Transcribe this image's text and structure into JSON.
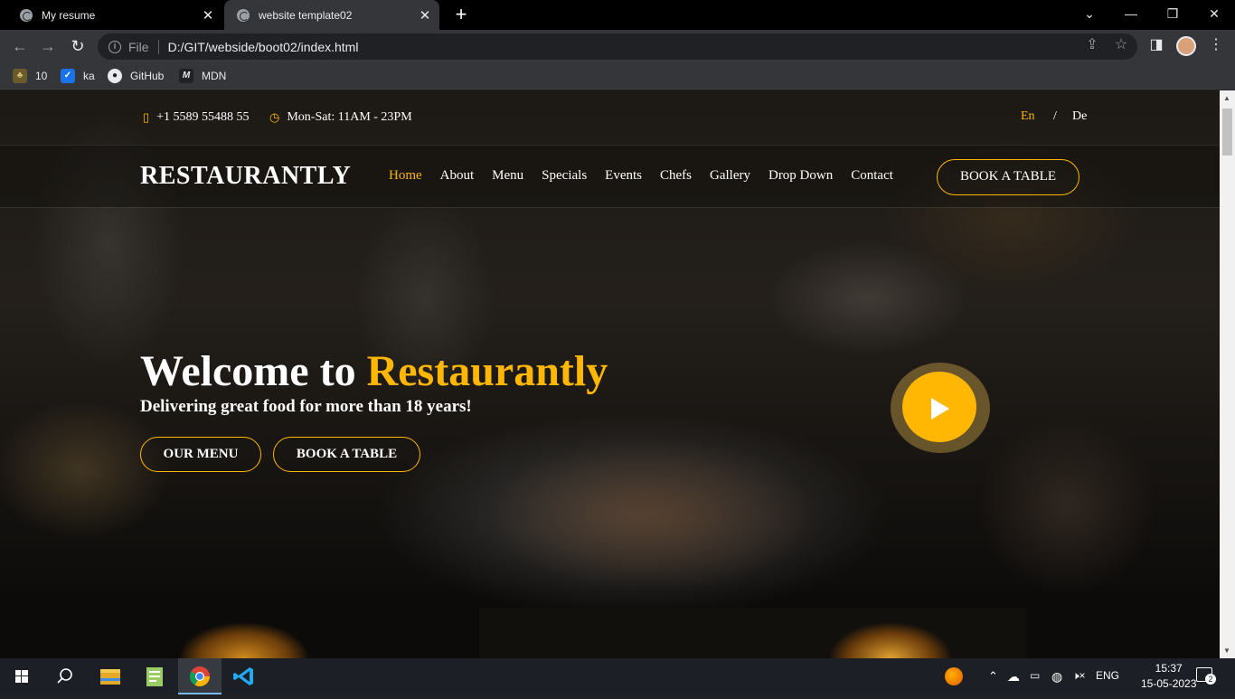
{
  "browser": {
    "tabs": [
      {
        "title": "My resume",
        "active": false
      },
      {
        "title": "website template02",
        "active": true
      }
    ],
    "url_scheme": "File",
    "url": "D:/GIT/webside/boot02/index.html",
    "bookmarks": [
      {
        "label": "10",
        "icon": "tree-icon"
      },
      {
        "label": "ka",
        "icon": "checkbox-icon"
      },
      {
        "label": "GitHub",
        "icon": "github-icon"
      },
      {
        "label": "MDN",
        "icon": "mdn-icon"
      }
    ]
  },
  "site": {
    "topbar": {
      "phone": "+1 5589 55488 55",
      "hours": "Mon-Sat: 11AM - 23PM",
      "lang_en": "En",
      "lang_sep": "/",
      "lang_de": "De"
    },
    "header": {
      "logo": "RESTAURANTLY",
      "nav": [
        "Home",
        "About",
        "Menu",
        "Specials",
        "Events",
        "Chefs",
        "Gallery",
        "Drop Down",
        "Contact"
      ],
      "active_nav": "Home",
      "book_button": "BOOK A TABLE"
    },
    "hero": {
      "title_prefix": "Welcome to ",
      "title_brand": "Restaurantly",
      "subtitle": "Delivering great food for more than 18 years!",
      "btn_menu": "OUR MENU",
      "btn_book": "BOOK A TABLE"
    },
    "accent_color": "#ffb703"
  },
  "taskbar": {
    "language": "ENG",
    "time": "15:37",
    "date": "15-05-2023",
    "notifications": "2"
  }
}
